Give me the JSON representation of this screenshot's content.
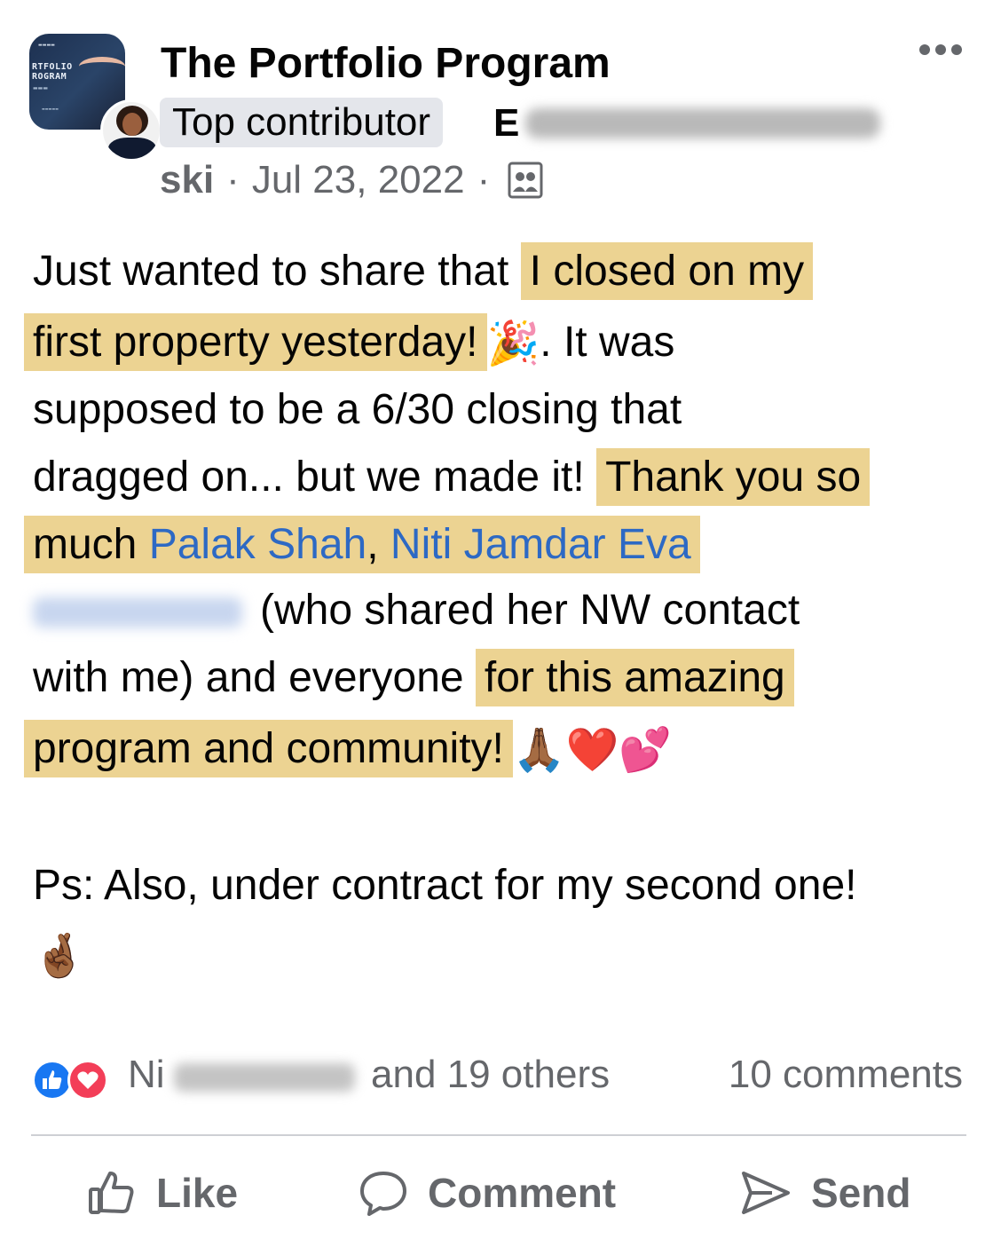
{
  "group": {
    "name": "The Portfolio Program",
    "avatar_lines": [
      "RTFOLIO",
      "ROGRAM"
    ]
  },
  "post": {
    "badge": "Top contributor",
    "author_first_visible": "E",
    "author_last_visible": "ski",
    "date": "Jul 23, 2022",
    "separator": "·",
    "audience_icon": "group-members-icon",
    "lines": {
      "l1_plain": "Just wanted to share that ",
      "l1_hl": "I closed on my",
      "l2_hl": "first property yesterday!",
      "l2_emoji": "🎉",
      "l2_plain": ". It was",
      "l3_plain": "supposed to be a 6/30 closing that",
      "l4_plain": "dragged on... but we made it! ",
      "l4_hl": "Thank you so",
      "l5_hl": "much ",
      "l5_mention1": "Palak Shah",
      "l5_comma": ", ",
      "l5_mention2": "Niti Jamdar Eva",
      "l6_plain": "(who shared her NW contact",
      "l7_plain": "with me) and everyone ",
      "l7_hl": "for this amazing",
      "l8_hl": "program and community!",
      "l8_emoji": "🙏🏾❤️💕",
      "l9_plain": "Ps: Also, under contract for my second one!",
      "l10_emoji": "🤞🏾"
    },
    "highlight_color": "#ecd392",
    "mention_color": "#2d69c4"
  },
  "reactions": {
    "types": [
      "like-icon",
      "love-icon"
    ],
    "first_visible": "Ni",
    "others_text": "and 19 others",
    "comments_text": "10 comments"
  },
  "actions": {
    "like_label": "Like",
    "comment_label": "Comment",
    "send_label": "Send"
  }
}
